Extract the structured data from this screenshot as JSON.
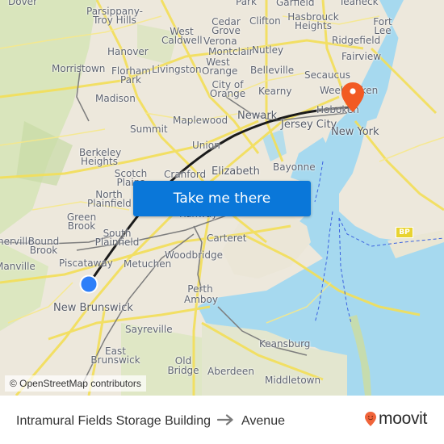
{
  "map": {
    "origin_marker": "origin-dot",
    "destination_marker": "destination-pin",
    "colors": {
      "route": "#1a1a1a",
      "origin": "#2d7ff9",
      "destination": "#f25a23",
      "water": "#a6d9ef",
      "land": "#efeadf",
      "roads": "#f5e05a",
      "cta": "#0a77d9"
    },
    "places": [
      {
        "name": "Dover"
      },
      {
        "name": "Parsippany-Troy Hills"
      },
      {
        "name": "Park"
      },
      {
        "name": "Garfield"
      },
      {
        "name": "Teaneck"
      },
      {
        "name": "Cedar Grove"
      },
      {
        "name": "Clifton"
      },
      {
        "name": "Hasbrouck Heights"
      },
      {
        "name": "Fort Lee"
      },
      {
        "name": "West Caldwell"
      },
      {
        "name": "Verona"
      },
      {
        "name": "Ridgefield"
      },
      {
        "name": "Hanover"
      },
      {
        "name": "Montclair"
      },
      {
        "name": "Nutley"
      },
      {
        "name": "Fairview"
      },
      {
        "name": "Morristown"
      },
      {
        "name": "Florham Park"
      },
      {
        "name": "Livingston"
      },
      {
        "name": "West Orange"
      },
      {
        "name": "Belleville"
      },
      {
        "name": "Secaucus"
      },
      {
        "name": "City of Orange"
      },
      {
        "name": "Kearny"
      },
      {
        "name": "Weehawken"
      },
      {
        "name": "Madison"
      },
      {
        "name": "Hoboken"
      },
      {
        "name": "Newark"
      },
      {
        "name": "Maplewood"
      },
      {
        "name": "Jersey City"
      },
      {
        "name": "New York"
      },
      {
        "name": "Summit"
      },
      {
        "name": "Union"
      },
      {
        "name": "Berkeley Heights"
      },
      {
        "name": "Scotch Plains"
      },
      {
        "name": "Cranford"
      },
      {
        "name": "Elizabeth"
      },
      {
        "name": "Bayonne"
      },
      {
        "name": "North Plainfield"
      },
      {
        "name": "Rahway"
      },
      {
        "name": "Green Brook"
      },
      {
        "name": "South Plainfield"
      },
      {
        "name": "Carteret"
      },
      {
        "name": "Somerville"
      },
      {
        "name": "Bound Brook"
      },
      {
        "name": "Manville"
      },
      {
        "name": "Piscataway"
      },
      {
        "name": "Metuchen"
      },
      {
        "name": "Woodbridge"
      },
      {
        "name": "Perth Amboy"
      },
      {
        "name": "New Brunswick"
      },
      {
        "name": "Sayreville"
      },
      {
        "name": "East Brunswick"
      },
      {
        "name": "Keansburg"
      },
      {
        "name": "Old Bridge"
      },
      {
        "name": "Aberdeen"
      },
      {
        "name": "Middletown"
      }
    ],
    "shield": "BP",
    "attribution": "© OpenStreetMap contributors"
  },
  "cta": {
    "label": "Take me there"
  },
  "footer": {
    "origin": "Intramural Fields Storage Building",
    "arrow_icon": "arrow-right-icon",
    "destination": "Avenue",
    "brand": "moovit"
  }
}
